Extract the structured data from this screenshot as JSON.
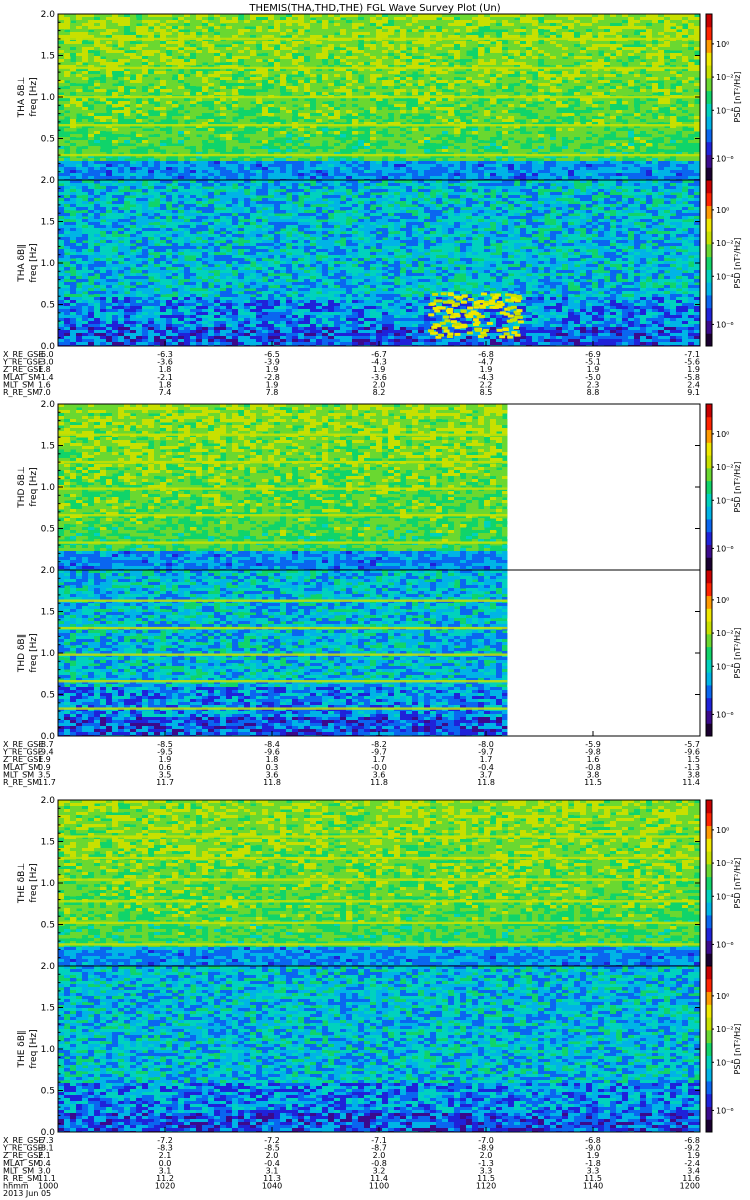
{
  "title": "THEMIS(THA,THD,THE) FGL Wave Survey Plot (Un)",
  "colors": {
    "colormap": [
      "#1a0030",
      "#3b0a8c",
      "#1f22d9",
      "#0a66f0",
      "#00b4e6",
      "#00d2be",
      "#10d46a",
      "#6ad830",
      "#c8e000",
      "#f0e800",
      "#ff9a00",
      "#ff2400",
      "#c80000"
    ],
    "axis": "#000000",
    "background": "#ffffff"
  },
  "colorbar": {
    "label": "PSD [nT²/Hz]",
    "ticks": [
      "10⁰",
      "10⁻²",
      "10⁻⁴",
      "10⁻⁶"
    ]
  },
  "freq_ticks": [
    "0.0",
    "0.5",
    "1.0",
    "1.5",
    "2.0"
  ],
  "footer": {
    "timestamp_label": "hhmm",
    "date": "2013 Jun 05",
    "time_ticks": [
      "1000",
      "1020",
      "1040",
      "1100",
      "1120",
      "1140",
      "1200"
    ]
  },
  "groups": [
    {
      "probe": "THA",
      "panels": [
        {
          "ylabel": "THA δB⊥",
          "yunit": "freq [Hz]",
          "lines": [
            0.3,
            0.66,
            1.0,
            1.35,
            1.7
          ],
          "data_end": 1.0
        },
        {
          "ylabel": "THA δB∥",
          "yunit": "freq [Hz]",
          "lines": [],
          "data_end": 1.0
        }
      ],
      "ephemeris": {
        "labels": [
          "X_RE_GSE",
          "Y_RE_GSE",
          "Z_RE_GSE",
          "MLAT_SM",
          "MLT_SM",
          "R_RE_SM"
        ],
        "columns": [
          [
            "-6.0",
            "-3.0",
            "1.8",
            "-1.4",
            "1.6",
            "7.0"
          ],
          [
            "-6.3",
            "-3.6",
            "1.8",
            "-2.1",
            "1.8",
            "7.4"
          ],
          [
            "-6.5",
            "-3.9",
            "1.9",
            "-2.8",
            "1.9",
            "7.8"
          ],
          [
            "-6.7",
            "-4.3",
            "1.9",
            "-3.6",
            "2.0",
            "8.2"
          ],
          [
            "-6.8",
            "-4.7",
            "1.9",
            "-4.3",
            "2.2",
            "8.5"
          ],
          [
            "-6.9",
            "-5.1",
            "1.9",
            "-5.0",
            "2.3",
            "8.8"
          ],
          [
            "-7.1",
            "-5.6",
            "1.9",
            "-5.8",
            "2.4",
            "9.1"
          ]
        ]
      }
    },
    {
      "probe": "THD",
      "panels": [
        {
          "ylabel": "THD δB⊥",
          "yunit": "freq [Hz]",
          "lines": [
            0.33,
            0.66,
            0.98,
            1.3,
            1.63
          ],
          "data_end": 0.7
        },
        {
          "ylabel": "THD δB∥",
          "yunit": "freq [Hz]",
          "lines": [
            0.33,
            0.66,
            0.98,
            1.3,
            1.63
          ],
          "data_end": 0.7
        }
      ],
      "ephemeris": {
        "labels": [
          "X_RE_GSE",
          "Y_RE_GSE",
          "Z_RE_GSE",
          "MLAT_SM",
          "MLT_SM",
          "R_RE_SM"
        ],
        "columns": [
          [
            "-8.7",
            "-9.4",
            "1.9",
            "0.9",
            "3.5",
            "11.7"
          ],
          [
            "-8.5",
            "-9.5",
            "1.9",
            "0.6",
            "3.5",
            "11.7"
          ],
          [
            "-8.4",
            "-9.6",
            "1.8",
            "0.3",
            "3.6",
            "11.8"
          ],
          [
            "-8.2",
            "-9.7",
            "1.7",
            "-0.0",
            "3.6",
            "11.8"
          ],
          [
            "-8.0",
            "-9.7",
            "1.7",
            "-0.4",
            "3.7",
            "11.8"
          ],
          [
            "-5.9",
            "-9.8",
            "1.6",
            "-0.8",
            "3.8",
            "11.5"
          ],
          [
            "-5.7",
            "-9.6",
            "1.5",
            "-1.3",
            "3.8",
            "11.4"
          ]
        ]
      }
    },
    {
      "probe": "THE",
      "panels": [
        {
          "ylabel": "THE δB⊥",
          "yunit": "freq [Hz]",
          "lines": [
            0.26,
            0.52,
            0.78,
            1.04,
            1.3,
            1.56
          ],
          "data_end": 1.0
        },
        {
          "ylabel": "THE δB∥",
          "yunit": "freq [Hz]",
          "lines": [],
          "data_end": 1.0
        }
      ],
      "ephemeris": {
        "labels": [
          "X_RE_GSE",
          "Y_RE_GSE",
          "Z_RE_GSE",
          "MLAT_SM",
          "MLT_SM",
          "R_RE_SM"
        ],
        "columns": [
          [
            "-7.3",
            "-8.1",
            "2.1",
            "0.4",
            "3.0",
            "11.1"
          ],
          [
            "-7.2",
            "-8.3",
            "2.1",
            "0.0",
            "3.1",
            "11.2"
          ],
          [
            "-7.2",
            "-8.5",
            "2.0",
            "-0.4",
            "3.1",
            "11.3"
          ],
          [
            "-7.1",
            "-8.7",
            "2.0",
            "-0.8",
            "3.2",
            "11.4"
          ],
          [
            "-7.0",
            "-8.9",
            "2.0",
            "-1.3",
            "3.3",
            "11.5"
          ],
          [
            "-6.8",
            "-9.0",
            "1.9",
            "-1.8",
            "3.3",
            "11.5"
          ],
          [
            "-6.8",
            "-9.2",
            "1.9",
            "-2.4",
            "3.4",
            "11.6"
          ]
        ]
      }
    }
  ],
  "chart_data": {
    "type": "heatmap",
    "title": "THEMIS(THA,THD,THE) FGL Wave Survey Plot (Un)",
    "x_label": "hhmm",
    "x_ticks": [
      "1000",
      "1020",
      "1040",
      "1100",
      "1120",
      "1140",
      "1200"
    ],
    "y_label": "freq [Hz]",
    "ylim": [
      0,
      2
    ],
    "colorbar_label": "PSD [nT²/Hz]",
    "colorbar_log": true,
    "colorbar_range": [
      "10⁻⁶",
      "10⁰"
    ],
    "panels": [
      "THA δB⊥",
      "THA δB∥",
      "THD δB⊥",
      "THD δB∥",
      "THE δB⊥",
      "THE δB∥"
    ]
  }
}
